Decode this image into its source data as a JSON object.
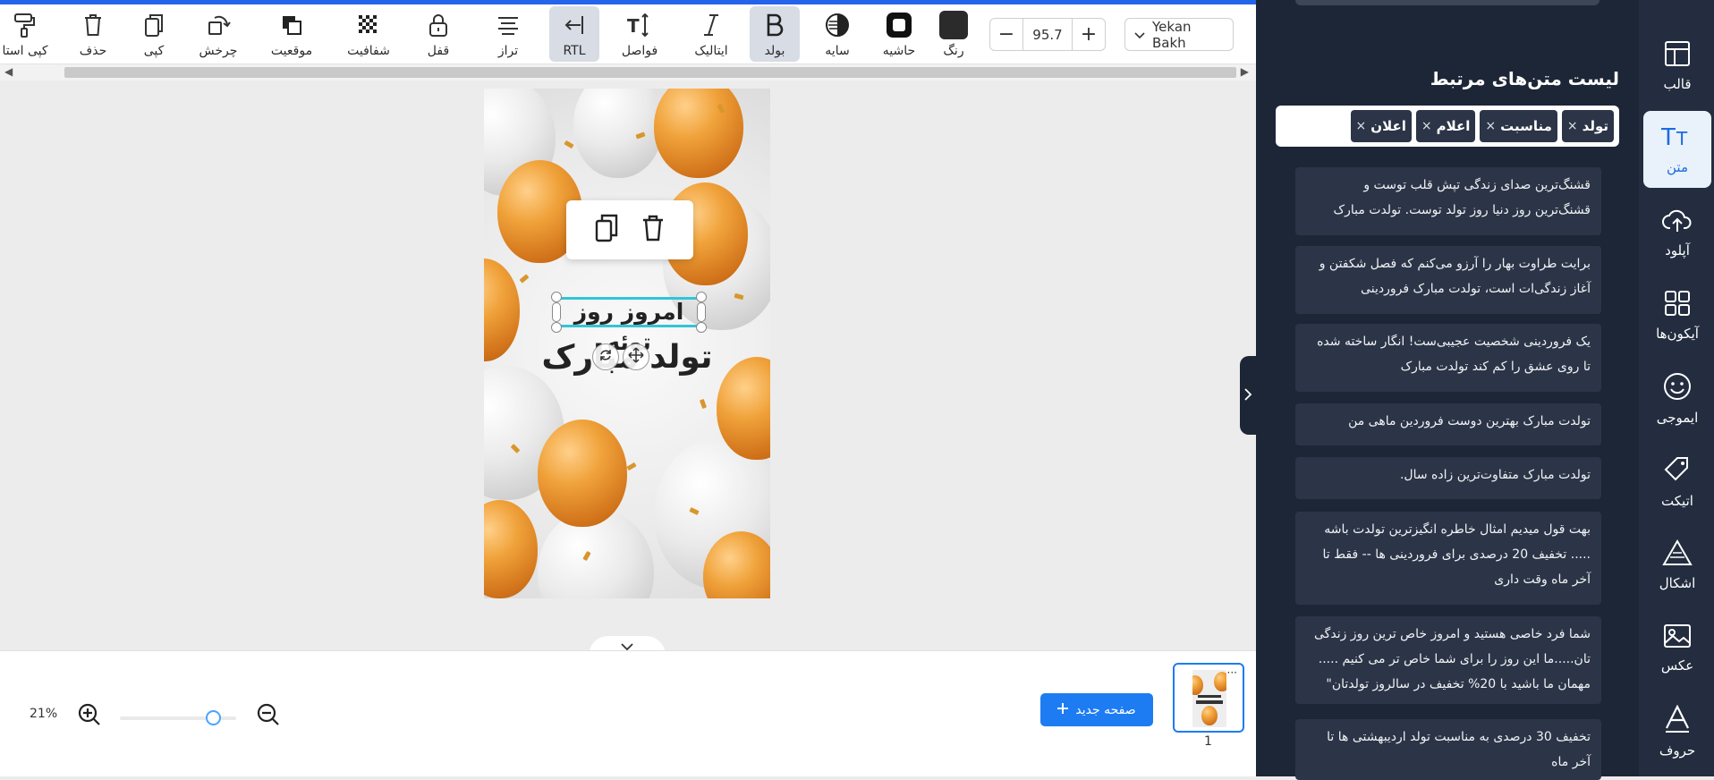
{
  "toolbar": {
    "tools": [
      {
        "id": "copy-style",
        "label": "کپی استا"
      },
      {
        "id": "delete",
        "label": "حذف"
      },
      {
        "id": "copy",
        "label": "کپی"
      },
      {
        "id": "rotate",
        "label": "چرخش"
      },
      {
        "id": "position",
        "label": "موقعیت"
      },
      {
        "id": "transparency",
        "label": "شفافیت"
      },
      {
        "id": "lock",
        "label": "قفل"
      },
      {
        "id": "align",
        "label": "تراز"
      },
      {
        "id": "rtl",
        "label": "RTL",
        "active": true
      },
      {
        "id": "spacing",
        "label": "فواصل"
      },
      {
        "id": "italic",
        "label": "ایتالیک"
      },
      {
        "id": "bold",
        "label": "بولد",
        "active": true
      },
      {
        "id": "shadow",
        "label": "سایه"
      },
      {
        "id": "border",
        "label": "حاشیه"
      },
      {
        "id": "color",
        "label": "رنگ"
      }
    ],
    "text_color": "#2b2b2b",
    "zoom_minus": "−",
    "zoom_value": "95.7",
    "zoom_plus": "+",
    "font_name": "Yekan Bakh"
  },
  "canvas": {
    "text_line1": "امروز روز توئه",
    "text_line2": "تولد مبارک",
    "accent": "#33c4d8"
  },
  "bottom": {
    "zoom_percent": "21%",
    "zoom_slider_level": 0.8,
    "new_page_label": "صفحه جدید",
    "page_number": "1",
    "thumb_menu": "···"
  },
  "panel": {
    "title": "لیست متن‌های مرتبط",
    "tags": [
      "تولد",
      "مناسبت",
      "اعلام",
      "اعلان"
    ],
    "cards": [
      "قشنگ‌ترین صدای زندگی تپش قلب توست و قشنگ‌ترین روز دنیا روز تولد توست. تولدت مبارک",
      "برایت طراوت بهار را آرزو می‌کنم که فصل شکفتن و آغاز زندگی‌ات است، تولدت مبارک فروردینی",
      "یک فروردینی شخصیت عجیبی‌ست! انگار ساخته شده تا روی عشق را کم کند تولدت مبارک",
      "تولدت مبارک بهترین دوست فروردین ماهی من",
      "تولدت مبارک متفاوت‌ترین زاده سال.",
      "بهت قول میدیم امثال خاطره انگیزترین تولدت باشه ..... تخفیف 20 درصدی برای فروردینی ها -- فقط تا آخر ماه وقت داری",
      "شما فرد خاصی هستید و امروز خاص ترین روز زندگی تان.....ما این روز را برای شما خاص تر می کنیم ..... مهمان ما باشید با 20% تخفیف در سالروز تولدتان\"",
      "تخفیف 30 درصدی به مناسبت تولد اردیبهشتی ها تا آخر ماه"
    ],
    "bg": "#1d2636",
    "card_bg": "#2c3547"
  },
  "sidebar": {
    "items": [
      {
        "id": "template",
        "label": "قالب",
        "icon": "layout-icon"
      },
      {
        "id": "text",
        "label": "متن",
        "icon": "text-icon",
        "active": true
      },
      {
        "id": "upload",
        "label": "آپلود",
        "icon": "upload-cloud-icon"
      },
      {
        "id": "icons",
        "label": "آیکون‌ها",
        "icon": "grid-icon"
      },
      {
        "id": "emoji",
        "label": "ایموجی",
        "icon": "smiley-icon"
      },
      {
        "id": "sticker",
        "label": "اتیکت",
        "icon": "tag-icon"
      },
      {
        "id": "shapes",
        "label": "اشکال",
        "icon": "shapes-icon"
      },
      {
        "id": "photo",
        "label": "عکس",
        "icon": "image-icon"
      },
      {
        "id": "letters",
        "label": "حروف",
        "icon": "letter-a-icon"
      }
    ],
    "active_color": "#1d6ae0"
  }
}
